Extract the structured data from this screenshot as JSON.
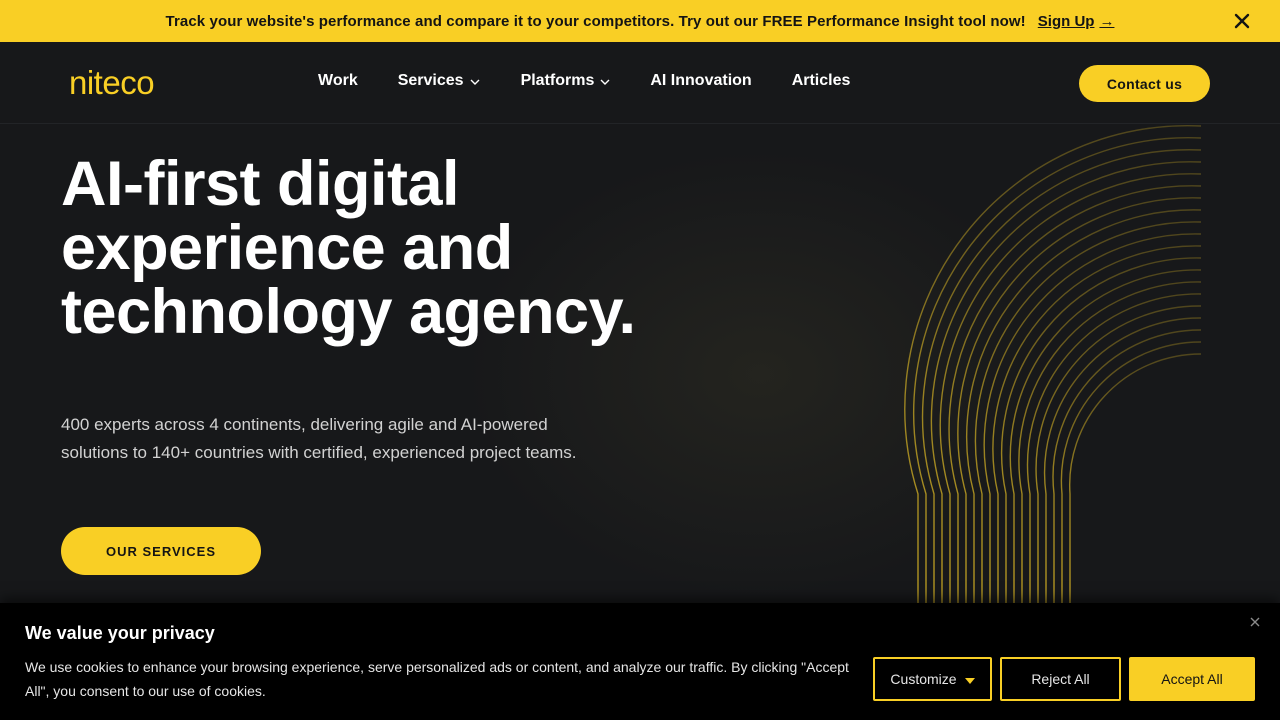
{
  "announcement": {
    "message": "Track your website's performance and compare it to your competitors. Try out our FREE Performance Insight tool now!",
    "link_label": "Sign Up",
    "arrow": "→",
    "close_icon": "close-icon"
  },
  "header": {
    "logo": "niteco",
    "nav": [
      {
        "label": "Work"
      },
      {
        "label": "Services",
        "icon": "chevron-down-icon"
      },
      {
        "label": "Platforms",
        "icon": "chevron-down-icon"
      },
      {
        "label": "AI Innovation"
      },
      {
        "label": "Articles"
      }
    ],
    "contact_label": "Contact us"
  },
  "hero": {
    "title": "AI-first digital experience and technology agency.",
    "subtitle": "400 experts across 4 continents, delivering agile and AI-powered solutions to 140+ countries with certified, experienced project teams.",
    "cta_label": "OUR SERVICES"
  },
  "cookie": {
    "title": "We value your privacy",
    "text": "We use cookies to enhance your browsing experience, serve personalized ads or content, and analyze our traffic. By clicking \"Accept All\", you consent to our use of cookies.",
    "customize_label": "Customize",
    "reject_label": "Reject All",
    "accept_label": "Accept All"
  },
  "colors": {
    "brand_yellow": "#f9cf25",
    "background": "#17181a",
    "cookie_bg": "#000000"
  }
}
